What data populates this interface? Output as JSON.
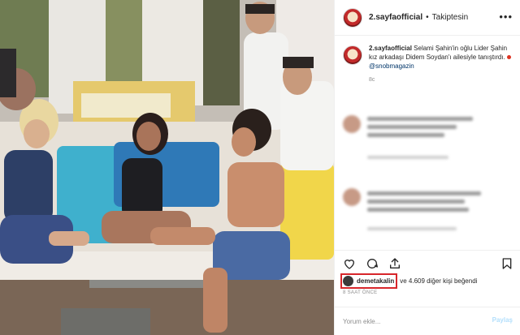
{
  "post": {
    "username": "2.sayfaofficial",
    "follow_status": "Takiptesin",
    "separator": "•",
    "more_label": "•••"
  },
  "caption": {
    "username": "2.sayfaofficial",
    "text": "Selami Şahin'in oğlu Lider Şahin kız arkadaşı Didem Soydan'ı ailesiyle tanıştırdı.",
    "mention": "@snobmagazin",
    "time": "8c"
  },
  "likes": {
    "liker": "demetakalin",
    "rest": "ve 4.609 diğer kişi beğendi"
  },
  "timestamp": "8 SAAT ÖNCE",
  "comment_input": {
    "placeholder": "Yorum ekle...",
    "submit_label": "Paylaş"
  },
  "icons": [
    "more-icon",
    "heart-icon",
    "comment-icon",
    "share-icon",
    "bookmark-icon"
  ],
  "colors": {
    "link": "#003569",
    "muted": "#8e8e8e",
    "highlight_box": "#d7262b"
  }
}
